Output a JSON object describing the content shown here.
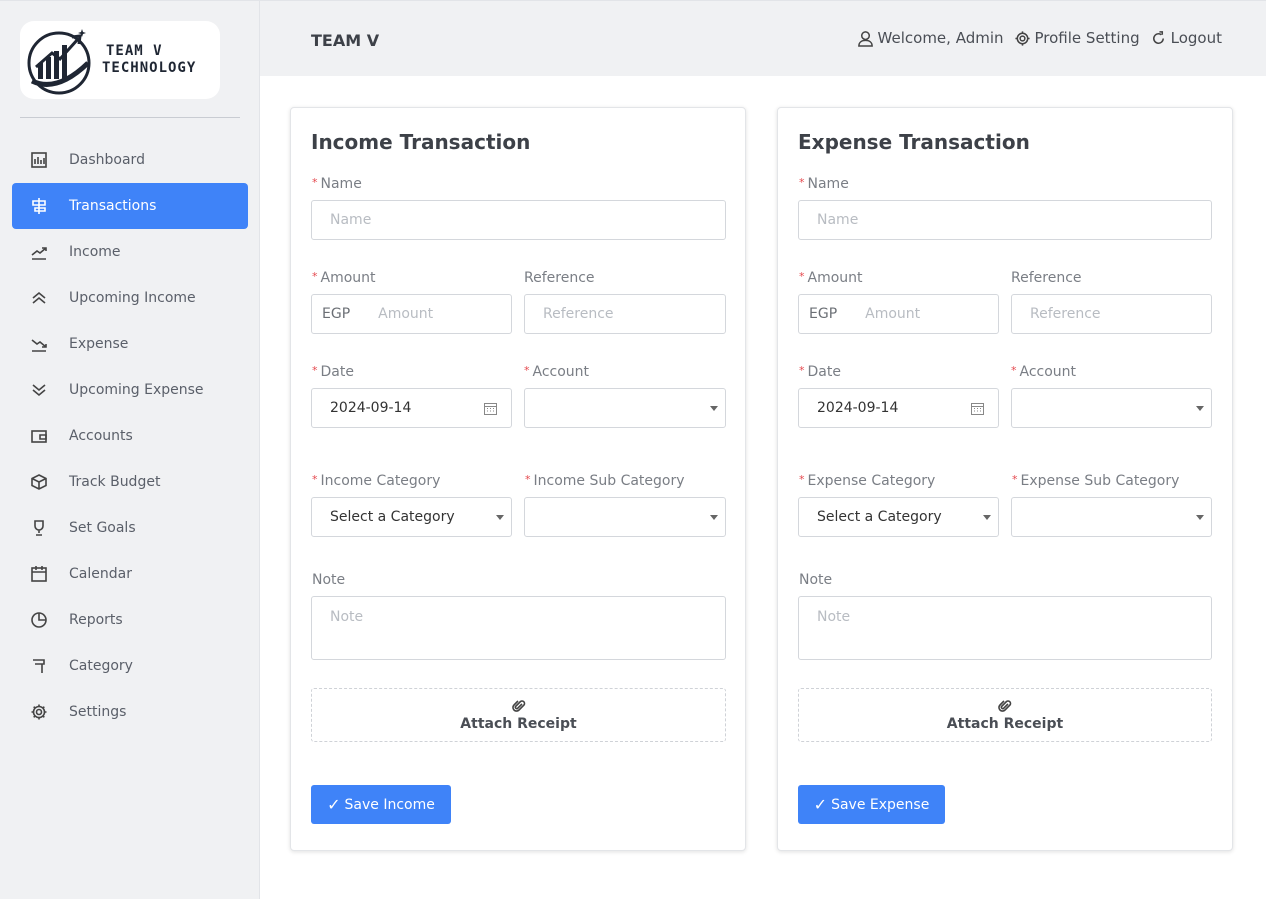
{
  "logo": {
    "line1": "TEAM V",
    "line2": "TECHNOLOGY"
  },
  "sidebar": {
    "items": [
      {
        "label": "Dashboard",
        "icon": "dashboard-icon",
        "active": false
      },
      {
        "label": "Transactions",
        "icon": "transactions-icon",
        "active": true
      },
      {
        "label": "Income",
        "icon": "trend-up-icon",
        "active": false
      },
      {
        "label": "Upcoming Income",
        "icon": "double-chevron-up-icon",
        "active": false
      },
      {
        "label": "Expense",
        "icon": "trend-down-icon",
        "active": false
      },
      {
        "label": "Upcoming Expense",
        "icon": "double-chevron-down-icon",
        "active": false
      },
      {
        "label": "Accounts",
        "icon": "wallet-icon",
        "active": false
      },
      {
        "label": "Track Budget",
        "icon": "box-icon",
        "active": false
      },
      {
        "label": "Set Goals",
        "icon": "trophy-icon",
        "active": false
      },
      {
        "label": "Calendar",
        "icon": "calendar-icon",
        "active": false
      },
      {
        "label": "Reports",
        "icon": "pie-chart-icon",
        "active": false
      },
      {
        "label": "Category",
        "icon": "flag-icon",
        "active": false
      },
      {
        "label": "Settings",
        "icon": "gear-icon",
        "active": false
      }
    ]
  },
  "header": {
    "brand": "TEAM V",
    "welcome": "Welcome, Admin",
    "profile": "Profile Setting",
    "logout": "Logout"
  },
  "income": {
    "title": "Income Transaction",
    "name_label": "Name",
    "name_placeholder": "Name",
    "amount_label": "Amount",
    "currency": "EGP",
    "amount_placeholder": "Amount",
    "reference_label": "Reference",
    "reference_placeholder": "Reference",
    "date_label": "Date",
    "date_value": "2024-09-14",
    "account_label": "Account",
    "account_value": "",
    "category_label": "Income Category",
    "category_value": "Select a Category",
    "subcategory_label": "Income Sub Category",
    "subcategory_value": "",
    "note_label": "Note",
    "note_placeholder": "Note",
    "attach_label": "Attach Receipt",
    "save_label": "Save Income"
  },
  "expense": {
    "title": "Expense Transaction",
    "name_label": "Name",
    "name_placeholder": "Name",
    "amount_label": "Amount",
    "currency": "EGP",
    "amount_placeholder": "Amount",
    "reference_label": "Reference",
    "reference_placeholder": "Reference",
    "date_label": "Date",
    "date_value": "2024-09-14",
    "account_label": "Account",
    "account_value": "",
    "category_label": "Expense Category",
    "category_value": "Select a Category",
    "subcategory_label": "Expense Sub Category",
    "subcategory_value": "",
    "note_label": "Note",
    "note_placeholder": "Note",
    "attach_label": "Attach Receipt",
    "save_label": "Save Expense"
  },
  "colors": {
    "accent": "#3f83f8",
    "sidebar_bg": "#f0f1f3",
    "required": "#e5484d"
  }
}
